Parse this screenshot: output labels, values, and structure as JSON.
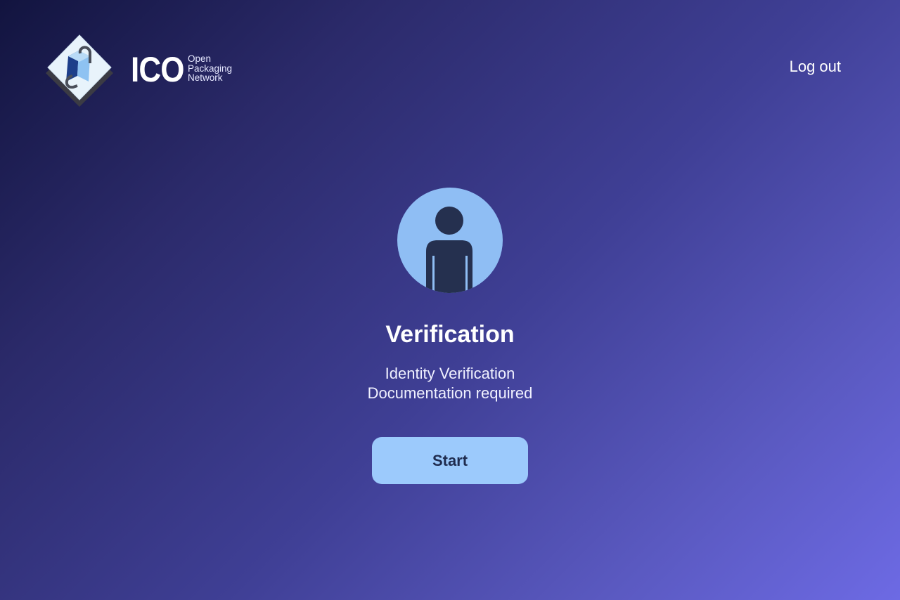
{
  "header": {
    "logo": {
      "wordmark": "ICO",
      "tagline": [
        "Open",
        "Packaging",
        "Network"
      ]
    },
    "logout_label": "Log out"
  },
  "verification": {
    "title": "Verification",
    "subtitle_lines": [
      "Identity Verification",
      "Documentation required"
    ],
    "start_label": "Start",
    "avatar_icon": "user-avatar-icon"
  },
  "colors": {
    "gradient_start": "#12143f",
    "gradient_end": "#6d6ae4",
    "accent_button": "#9ccafc",
    "button_text": "#1f2c4f",
    "avatar_bg": "#8fbef4",
    "avatar_figure": "#25304f"
  }
}
